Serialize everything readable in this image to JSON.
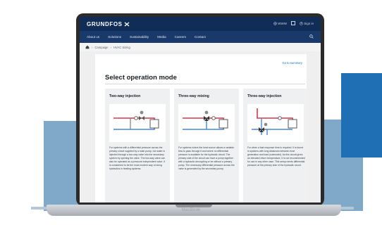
{
  "device": {
    "label": "MacBook"
  },
  "header": {
    "logo": "GRUNDFOS",
    "links": [
      "WWW",
      "Sign in"
    ]
  },
  "nav": {
    "items": [
      "About us",
      "Solutions",
      "Sustainability",
      "Media",
      "Careers",
      "Contact"
    ]
  },
  "breadcrumb": {
    "items": [
      "Campaign",
      "HVAC Sizing"
    ]
  },
  "page": {
    "go_to_summary": "Go to summary",
    "title": "Select operation mode",
    "cards": [
      {
        "title": "Two-way injection",
        "text": "For systems with a differential pressure across the primary circuit supplied by a main pump, hot water is injected through a two-way valve into the secondary system by opening the valve. The two-way valve can also be operated as a pressure independent valve. It is considered to be the most modern way of doing hydraulics in heating systems."
      },
      {
        "title": "Three-way mixing",
        "text": "For systems where the heat source allows a variable flow to pass through it and where no differential pressure is available for the hydraulic circuit. The primary side of the circuit can have a pump together with a hydraulic decoupling or be without a primary pump. The necessary differential pressure across the valve is generated by the secondary pump."
      },
      {
        "title": "Three-way injection",
        "text": "For when a fast response time is required. It is found in systems with long distances between heat generation and load (submodel). As this circuit gives an elevated return temperature, it is not recommended for use in any other case. This setup needs differential pressure at the primary side of the hydraulic circuit."
      }
    ]
  },
  "colors": {
    "supply": "#d7364a",
    "return": "#4a86d6",
    "brand": "#0f2d56"
  }
}
